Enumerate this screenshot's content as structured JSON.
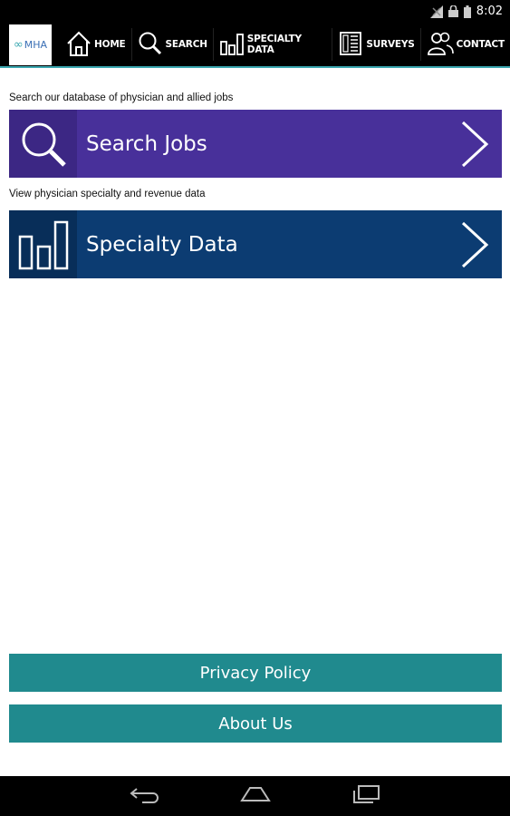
{
  "status_bar": {
    "time": "8:02",
    "icons": [
      "signal-icon",
      "lock-icon",
      "battery-icon"
    ]
  },
  "nav": {
    "logo_text": "MHA",
    "items": [
      {
        "label": "HOME",
        "icon": "home-icon"
      },
      {
        "label": "SEARCH",
        "icon": "search-icon"
      },
      {
        "label": "SPECIALTY DATA",
        "icon": "bar-chart-icon"
      },
      {
        "label": "SURVEYS",
        "icon": "calculator-icon"
      },
      {
        "label": "CONTACT",
        "icon": "people-icon"
      }
    ]
  },
  "main": {
    "search_caption": "Search our database of physician and allied jobs",
    "search_tile_label": "Search Jobs",
    "specialty_caption": "View physician specialty and revenue data",
    "specialty_tile_label": "Specialty Data"
  },
  "footer": {
    "privacy_label": "Privacy Policy",
    "about_label": "About Us"
  },
  "colors": {
    "search_tile": "#48309a",
    "specialty_tile": "#0c3c72",
    "footer_button": "#208a8e",
    "accent_line": "#3aa7b0"
  }
}
